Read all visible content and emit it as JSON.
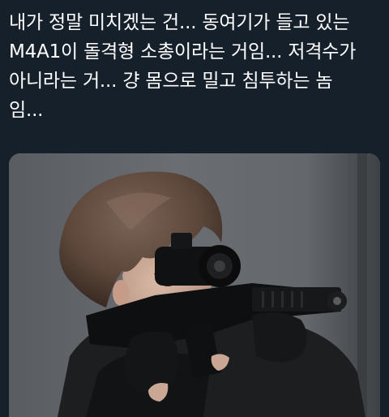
{
  "tweet": {
    "text_lines": [
      "내가 정말 미치겠는 건... 동여기가 들고 있는",
      "M4A1이 돌격형 소총이라는 거임... 저격수가",
      "아니라는 거... 걍 몸으로 밀고 침투하는 놈",
      "임..."
    ]
  },
  "media": {
    "subject_icon": "person-aiming-rifle-photo",
    "colors": {
      "background": "#15202b",
      "text": "#ffffff",
      "photo_backdrop": "#5f6367"
    }
  }
}
